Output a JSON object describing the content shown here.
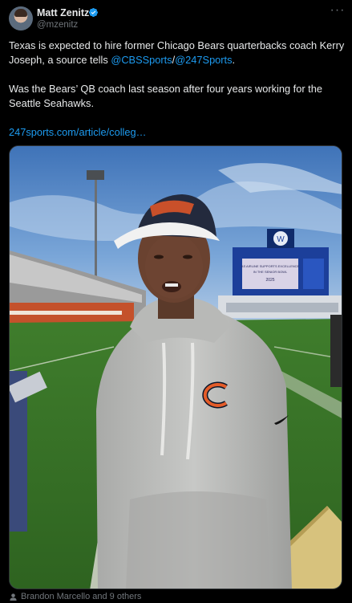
{
  "author": {
    "display_name": "Matt Zenitz",
    "handle": "@mzenitz"
  },
  "post": {
    "line1_prefix": "Texas is expected to hire former Chicago Bears quarterbacks coach Kerry Joseph, a source tells ",
    "mention1": "@CBSSports",
    "slash": "/",
    "mention2": "@247Sports",
    "line1_suffix": ".",
    "paragraph2": "Was the Bears’ QB coach last season after four years working for the Seattle Seahawks.",
    "link": "247sports.com/article/colleg…"
  },
  "photo": {
    "scoreboard_line1": "AS AIRLINE SUPPORTS EXCELLENCE",
    "scoreboard_line2": "IN THE SENIOR BOWL",
    "scoreboard_line3": "2025",
    "scoreboard_logo": "W"
  },
  "tagged": "Brandon Marcello and 9 others",
  "colors": {
    "background": "#000000",
    "text": "#e7e9ea",
    "muted": "#71767b",
    "link": "#1d9bf0",
    "bears_orange": "#e35c29",
    "bears_navy": "#0b162a"
  },
  "icons": {
    "verified": "verified-badge-icon",
    "more": "more-horizontal-icon",
    "tag": "person-tag-icon"
  }
}
